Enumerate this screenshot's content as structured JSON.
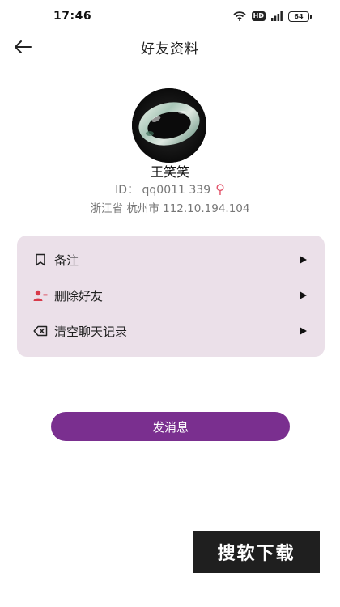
{
  "status_bar": {
    "time": "17:46",
    "network_badge": "HD",
    "battery_level": "64",
    "icons": [
      "wifi-icon",
      "signal-icon",
      "battery-icon"
    ]
  },
  "header": {
    "back_icon": "arrow-left-icon",
    "title": "好友资料"
  },
  "profile": {
    "avatar_icon": "jade-bracelet-avatar",
    "name": "王笑笑",
    "id_text": "ID： qq0011 339",
    "gender_icon": "female-icon",
    "gender_symbol": "♀",
    "location": "浙江省 杭州市 112.10.194.104"
  },
  "actions": [
    {
      "label": "备注",
      "icon": "bookmark-icon"
    },
    {
      "label": "删除好友",
      "icon": "remove-user-icon"
    },
    {
      "label": "清空聊天记录",
      "icon": "clear-icon"
    }
  ],
  "send_button": {
    "label": "发消息"
  },
  "watermark": {
    "text": "搜软下载"
  },
  "colors": {
    "accent": "#7a2f8f",
    "card_background": "#ebe0e9",
    "female_icon": "#e2536a",
    "remove_user_icon": "#d83a4a"
  }
}
